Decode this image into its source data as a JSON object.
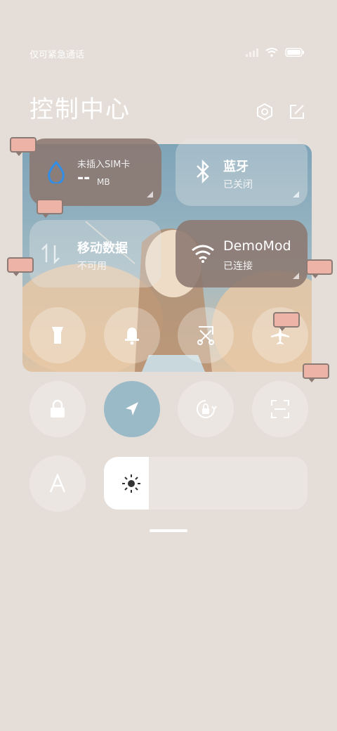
{
  "status": {
    "carrier_text": "仅可紧急通话"
  },
  "header": {
    "title": "控制中心"
  },
  "tiles": {
    "data_usage": {
      "title": "未插入SIM卡",
      "value": "--",
      "unit": "MB"
    },
    "bluetooth": {
      "title": "蓝牙",
      "status": "已关闭"
    },
    "mobile_data": {
      "title": "移动数据",
      "status": "不可用"
    },
    "wifi": {
      "title": "DemoMod",
      "status": "已连接"
    }
  },
  "colors": {
    "accent": "#9bbac7",
    "data_icon": "#2f8fe8",
    "background": "#e5ddd7"
  },
  "icons": [
    "signal-icon",
    "wifi-icon",
    "battery-icon",
    "settings-icon",
    "edit-icon",
    "water-drop-icon",
    "bluetooth-icon",
    "mobile-data-icon",
    "flashlight-icon",
    "bell-icon",
    "screenshot-icon",
    "airplane-icon",
    "lock-icon",
    "location-icon",
    "rotation-lock-icon",
    "scan-icon",
    "font-icon",
    "brightness-icon"
  ],
  "brightness": {
    "level": 0.22
  }
}
